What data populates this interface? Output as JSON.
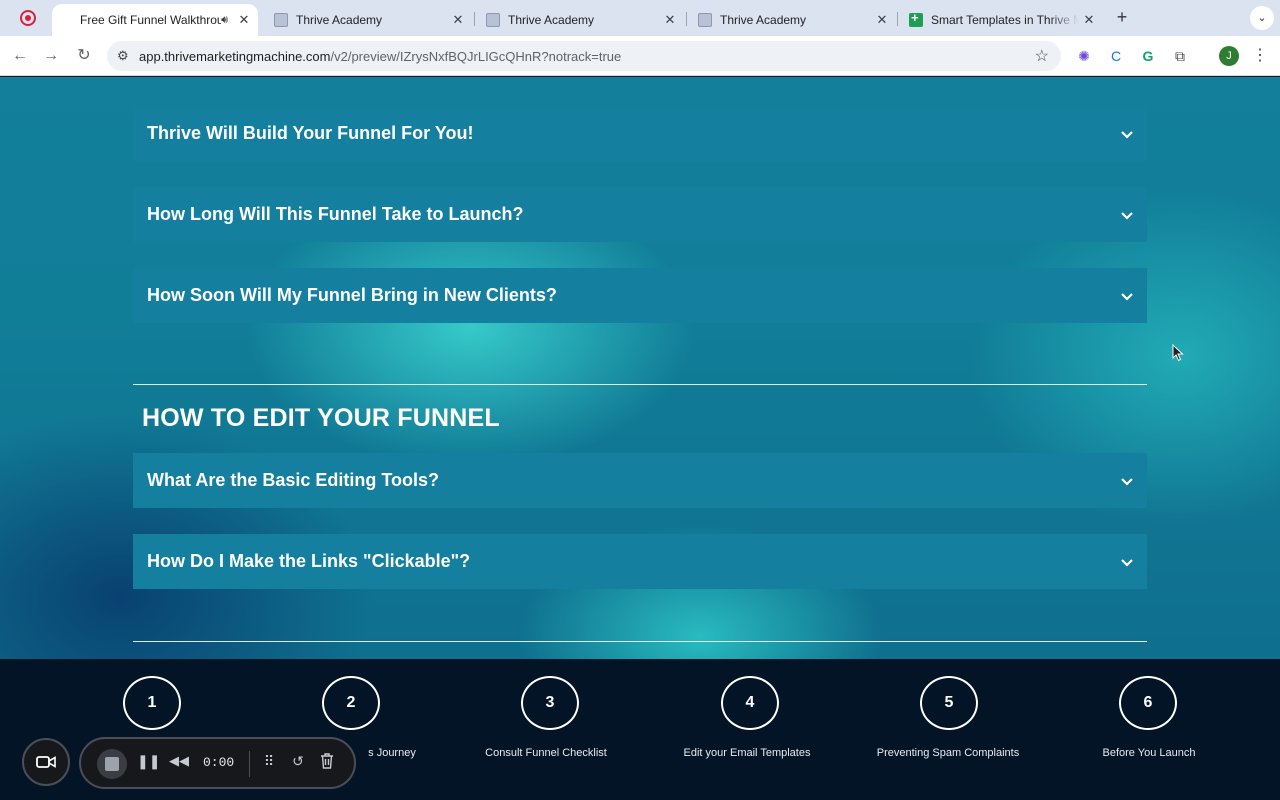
{
  "browser": {
    "tabs": [
      {
        "title": "Free Gift Funnel Walkthrou",
        "active": true,
        "audio": true,
        "icon": "recording-icon"
      },
      {
        "title": "Thrive Academy",
        "active": false,
        "icon": "thrive-favicon"
      },
      {
        "title": "Thrive Academy",
        "active": false,
        "icon": "thrive-favicon"
      },
      {
        "title": "Thrive Academy",
        "active": false,
        "icon": "thrive-favicon"
      },
      {
        "title": "Smart Templates in Thrive Ma",
        "active": false,
        "icon": "sheets-favicon"
      }
    ],
    "close_glyph": "✕",
    "new_tab_glyph": "+",
    "url_host": "app.thrivemarketingmachine.com",
    "url_path": "/v2/preview/IZrysNxfBQJrLIGcQHnR?notrack=true",
    "profile_initial": "J"
  },
  "page": {
    "faqs_top": [
      {
        "question": "Thrive Will Build Your Funnel For You!"
      },
      {
        "question": "How Long Will This Funnel Take to Launch?"
      },
      {
        "question": "How Soon Will My Funnel Bring in New Clients?"
      }
    ],
    "section_title": "HOW TO EDIT YOUR FUNNEL",
    "faqs_edit": [
      {
        "question": "What Are the Basic Editing Tools?"
      },
      {
        "question": "How Do I Make the Links \"Clickable\"?"
      }
    ]
  },
  "bottom_nav": {
    "steps": [
      {
        "number": "1",
        "label": ""
      },
      {
        "number": "2",
        "label": "s Journey"
      },
      {
        "number": "3",
        "label": "Consult Funnel Checklist"
      },
      {
        "number": "4",
        "label": "Edit your Email Templates"
      },
      {
        "number": "5",
        "label": "Preventing Spam Complaints"
      },
      {
        "number": "6",
        "label": "Before You Launch"
      }
    ]
  },
  "recorder": {
    "timer": "0:00"
  },
  "colors": {
    "faq_bg": "#147f9e",
    "footer_bg": "#031426",
    "page_teal": "#137f9b"
  }
}
